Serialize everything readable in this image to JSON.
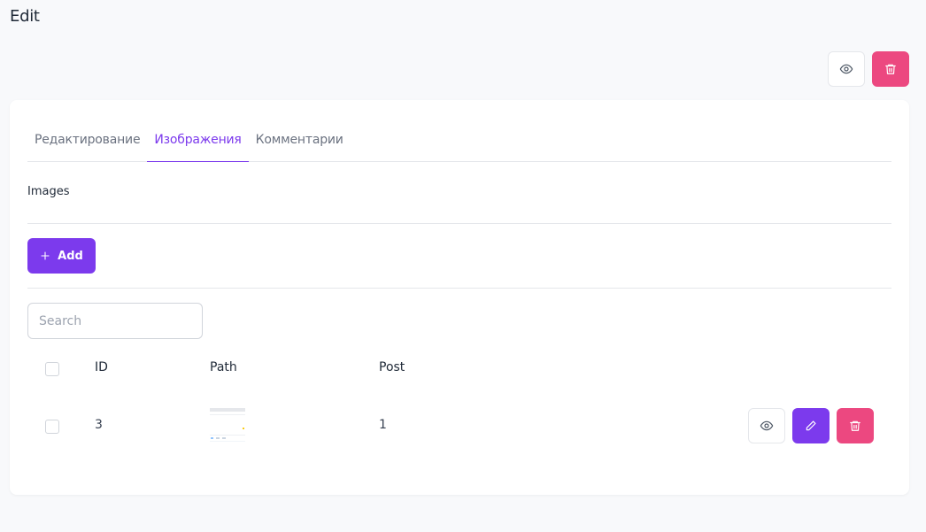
{
  "page": {
    "title": "Edit"
  },
  "top_actions": {
    "view_icon": "eye-icon",
    "delete_icon": "trash-icon"
  },
  "tabs": [
    {
      "label": "Редактирование",
      "active": false
    },
    {
      "label": "Изображения",
      "active": true
    },
    {
      "label": "Комментарии",
      "active": false
    }
  ],
  "section": {
    "label": "Images"
  },
  "toolbar": {
    "add_label": "Add",
    "add_icon": "plus-icon"
  },
  "search": {
    "placeholder": "Search",
    "value": ""
  },
  "table": {
    "columns": [
      "ID",
      "Path",
      "Post"
    ],
    "rows": [
      {
        "id": "3",
        "path_thumbnail": "image-thumbnail",
        "post": "1"
      }
    ]
  },
  "colors": {
    "accent": "#7c3aed",
    "danger": "#ec4880",
    "background": "#f8f9fb"
  }
}
